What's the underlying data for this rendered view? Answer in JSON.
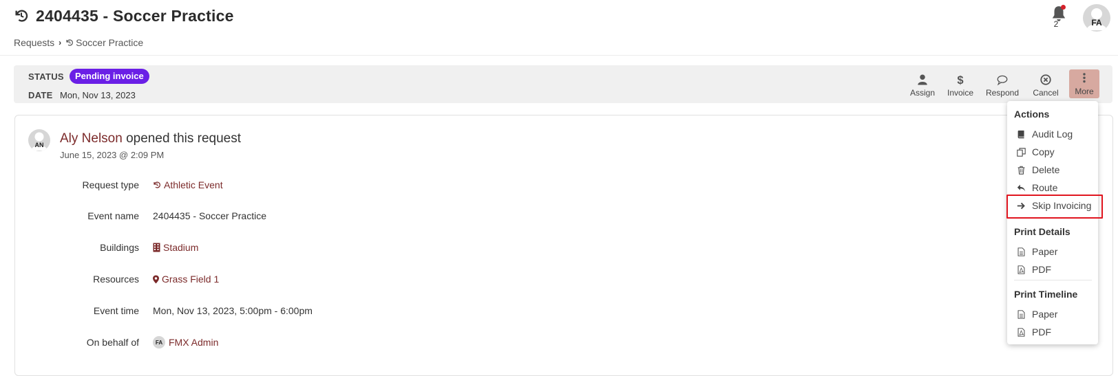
{
  "header": {
    "title": "2404435 - Soccer Practice",
    "notification_count": "2",
    "user_initials": "FA"
  },
  "breadcrumb": {
    "root": "Requests",
    "current": "Soccer Practice"
  },
  "status": {
    "status_label": "STATUS",
    "status_value": "Pending invoice",
    "date_label": "DATE",
    "date_value": "Mon, Nov 13, 2023"
  },
  "actions": {
    "assign": "Assign",
    "invoice": "Invoice",
    "respond": "Respond",
    "cancel": "Cancel",
    "more": "More"
  },
  "activity": {
    "initials": "AN",
    "user": "Aly Nelson",
    "verb": "opened this request",
    "timestamp": "June 15, 2023 @ 2:09 PM"
  },
  "details": {
    "request_type_label": "Request type",
    "request_type_value": "Athletic Event",
    "event_name_label": "Event name",
    "event_name_value": "2404435 - Soccer Practice",
    "buildings_label": "Buildings",
    "buildings_value": "Stadium",
    "resources_label": "Resources",
    "resources_value": "Grass Field 1",
    "event_time_label": "Event time",
    "event_time_value": "Mon, Nov 13, 2023, 5:00pm - 6:00pm",
    "on_behalf_label": "On behalf of",
    "on_behalf_initials": "FA",
    "on_behalf_value": "FMX Admin"
  },
  "menu": {
    "actions_heading": "Actions",
    "audit_log": "Audit Log",
    "copy": "Copy",
    "delete": "Delete",
    "route": "Route",
    "skip_invoicing": "Skip Invoicing",
    "print_details_heading": "Print Details",
    "details_paper": "Paper",
    "details_pdf": "PDF",
    "print_timeline_heading": "Print Timeline",
    "timeline_paper": "Paper",
    "timeline_pdf": "PDF"
  },
  "colors": {
    "pill": "#6a1fe6",
    "link": "#7b2a2a",
    "highlight": "#e0141e",
    "more_button": "#d7a9a0"
  }
}
